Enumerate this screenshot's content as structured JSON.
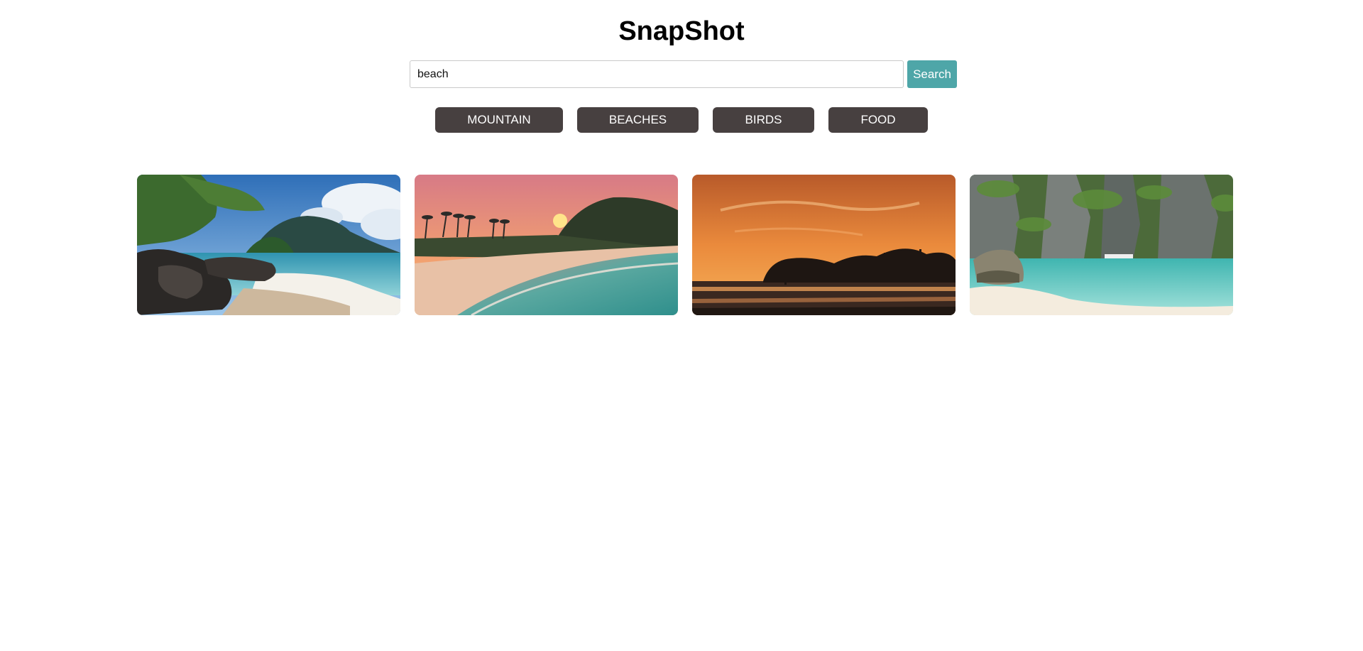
{
  "app": {
    "title": "SnapShot"
  },
  "search": {
    "value": "beach",
    "button_label": "Search"
  },
  "categories": [
    {
      "label": "MOUNTAIN"
    },
    {
      "label": "BEACHES"
    },
    {
      "label": "BIRDS"
    },
    {
      "label": "FOOD"
    }
  ],
  "colors": {
    "search_button": "#4ea6a8",
    "category_button": "#474040",
    "background": "#ffffff"
  },
  "gallery": {
    "images": [
      {
        "name": "beach-rocks-tree-photo"
      },
      {
        "name": "beach-pink-sunset-palms-photo"
      },
      {
        "name": "orange-sunset-silhouette-photo"
      },
      {
        "name": "turquoise-lagoon-cliffs-photo"
      }
    ]
  }
}
